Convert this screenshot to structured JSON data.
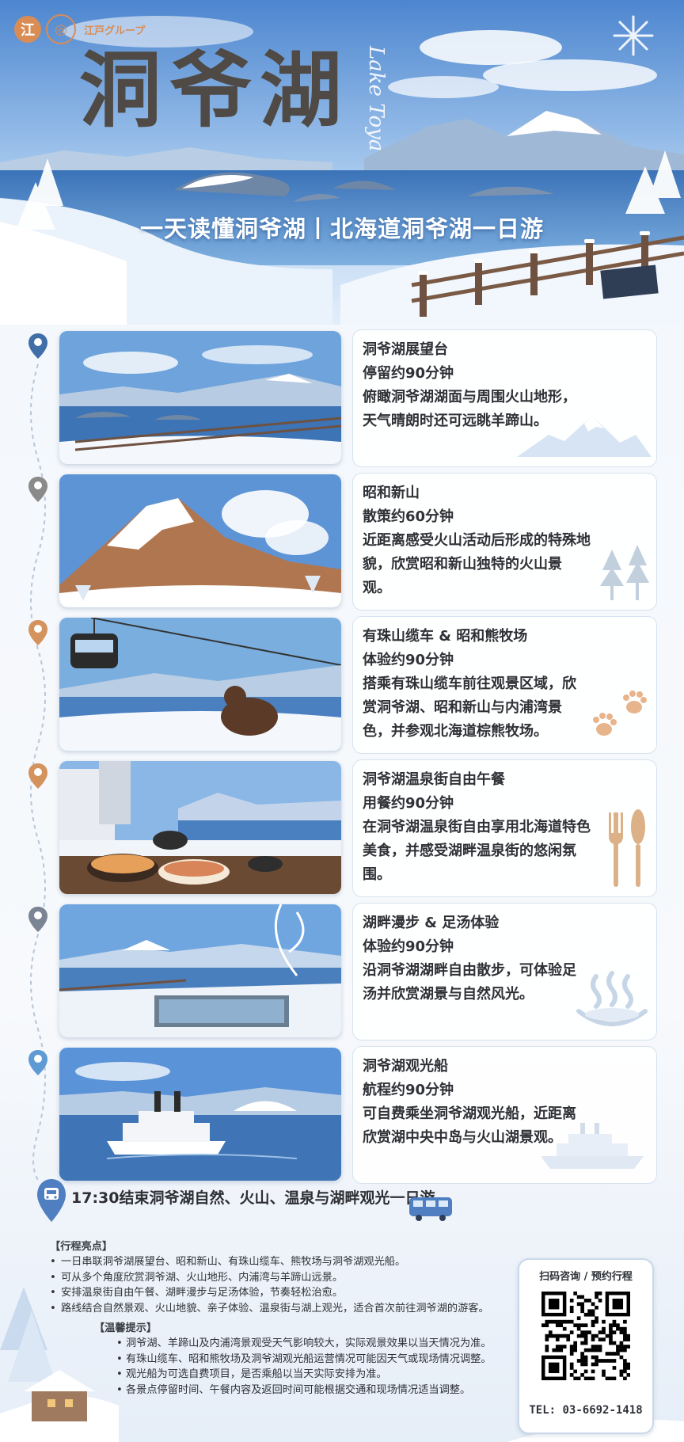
{
  "brand": {
    "logo_text": "江戸グループ"
  },
  "hero": {
    "title": "洞爷湖",
    "title_en": "Lake Toya",
    "subtitle": "一天读懂洞爷湖丨北海道洞爷湖一日游"
  },
  "stops": [
    {
      "name": "洞爷湖展望台",
      "duration": "停留约90分钟",
      "lines": [
        "俯瞰洞爷湖湖面与周围火山地形，",
        "天气晴朗时还可远眺羊蹄山。"
      ],
      "pin_color": "#3f6fa6",
      "deco": "mountain-icon"
    },
    {
      "name": "昭和新山",
      "duration": "散策约60分钟",
      "lines": [
        "近距离感受火山活动后形成的特殊地",
        "貌，欣赏昭和新山独特的火山景",
        "观。"
      ],
      "pin_color": "#8a8a8a",
      "deco": "tree-icon"
    },
    {
      "name": "有珠山缆车 & 昭和熊牧场",
      "duration": "体验约90分钟",
      "lines": [
        "搭乘有珠山缆车前往观景区域，欣",
        "赏洞爷湖、昭和新山与内浦湾景",
        "色，并参观北海道棕熊牧场。"
      ],
      "pin_color": "#d4925c",
      "deco": "paw-icon"
    },
    {
      "name": "洞爷湖温泉街自由午餐",
      "duration": "用餐约90分钟",
      "lines": [
        "在洞爷湖温泉街自由享用北海道特色",
        "美食，并感受湖畔温泉街的悠闲氛",
        "围。"
      ],
      "pin_color": "#d4925c",
      "deco": "cutlery-icon"
    },
    {
      "name": "湖畔漫步 & 足汤体验",
      "duration": "体验约90分钟",
      "lines": [
        "沿洞爷湖湖畔自由散步，可体验足",
        "汤并欣赏湖景与自然风光。"
      ],
      "pin_color": "#7a8494",
      "deco": "hot-spring-icon"
    },
    {
      "name": "洞爷湖观光船",
      "duration": "航程约90分钟",
      "lines": [
        "可自费乘坐洞爷湖观光船，近距离",
        "欣赏湖中央中岛与火山湖景观。"
      ],
      "pin_color": "#5e9ad4",
      "deco": "ship-icon"
    }
  ],
  "end": {
    "text": "17:30结束洞爷湖自然、火山、温泉与湖畔观光一日游。"
  },
  "highlights": {
    "title": "【行程亮点】",
    "items": [
      "一日串联洞爷湖展望台、昭和新山、有珠山缆车、熊牧场与洞爷湖观光船。",
      "可从多个角度欣赏洞爷湖、火山地形、内浦湾与羊蹄山远景。",
      "安排温泉街自由午餐、湖畔漫步与足汤体验，节奏轻松治愈。",
      "路线结合自然景观、火山地貌、亲子体验、温泉街与湖上观光，适合首次前往洞爷湖的游客。"
    ]
  },
  "tips": {
    "title": "【温馨提示】",
    "items": [
      "洞爷湖、羊蹄山及内浦湾景观受天气影响较大，实际观景效果以当天情况为准。",
      "有珠山缆车、昭和熊牧场及洞爷湖观光船运营情况可能因天气或现场情况调整。",
      "观光船为可选自费项目，是否乘船以当天实际安排为准。",
      "各景点停留时间、午餐内容及返回时间可能根据交通和现场情况适当调整。"
    ]
  },
  "contact": {
    "title": "扫码咨询 / 预约行程",
    "tel": "TEL: 03-6692-1418"
  },
  "colors": {
    "title": "#4f4a45",
    "accent": "#d98c54",
    "sky": "#3f78c4"
  }
}
